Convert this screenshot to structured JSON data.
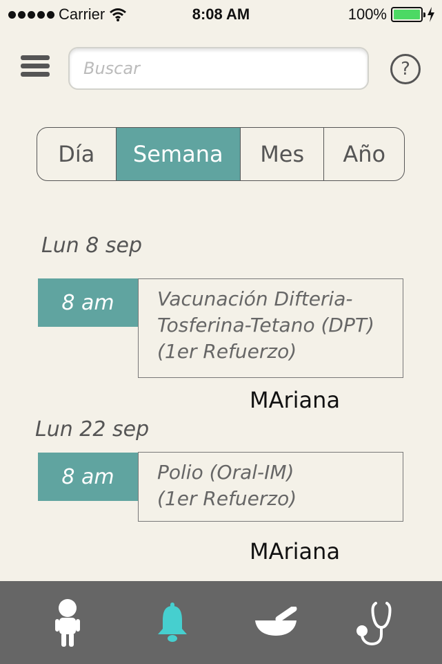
{
  "status_bar": {
    "carrier": "Carrier",
    "time": "8:08 AM",
    "battery": "100%"
  },
  "search": {
    "placeholder": "Buscar"
  },
  "help": {
    "label": "?"
  },
  "segments": [
    "Día",
    "Semana",
    "Mes",
    "Año"
  ],
  "selected_segment": "Semana",
  "events": [
    {
      "date": "Lun 8 sep",
      "time": "8 am",
      "lines": [
        "Vacunación Difteria-",
        "Tosferina-Tetano (DPT)",
        "(1er Refuerzo)"
      ],
      "patient": "MAriana"
    },
    {
      "date": "Lun 22 sep",
      "time": "8 am",
      "lines": [
        "Polio (Oral-IM)",
        "(1er Refuerzo)"
      ],
      "patient": "MAriana"
    }
  ],
  "tabs": [
    {
      "icon": "child-icon"
    },
    {
      "icon": "bell-icon",
      "active": true
    },
    {
      "icon": "mortar-pestle-icon"
    },
    {
      "icon": "stethoscope-icon"
    }
  ],
  "colors": {
    "background": "#f4f1e8",
    "accent": "#60a4a0",
    "tabbar": "#666666",
    "active_tab_icon": "#46cfcf",
    "battery": "#4cd964"
  }
}
